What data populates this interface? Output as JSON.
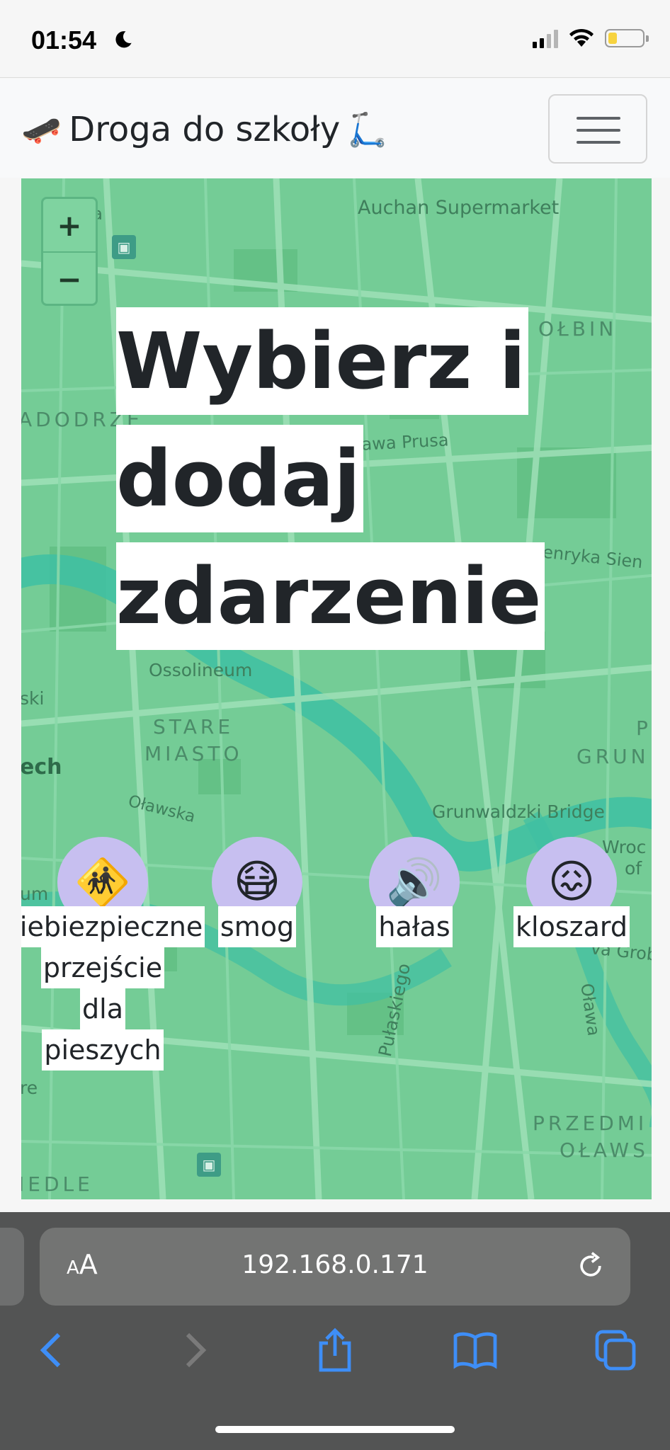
{
  "status_bar": {
    "time": "01:54",
    "battery_level": 0.25
  },
  "navbar": {
    "brand_text": "Droga do szkoły",
    "brand_emoji_left": "🛹",
    "brand_emoji_right": "🛴"
  },
  "map": {
    "zoom_in": "+",
    "zoom_out": "−",
    "labels": {
      "l1": "owska",
      "l2": "Auchan Supermarket",
      "l3": "OŁBIN",
      "l4": "ADODRZE",
      "l5": "olesława Prusa",
      "l6": "Henryka Sien",
      "l7": "Ossolineum",
      "l8": "ski",
      "l9": "STARE",
      "l10": "MIASTO",
      "l11": "ech",
      "l12": "Oławska",
      "l13": "Grunwaldzki Bridge",
      "l14": "GRUN",
      "l15": "P",
      "l16": "Wroc",
      "l17": "of",
      "l18": "um",
      "l19": "va Grob",
      "l20": "Oława",
      "l21": "Pułaskiego",
      "l22": "re",
      "l23": "PRZEDMI",
      "l24": "OŁAWS",
      "l25": "IEDLE"
    }
  },
  "headline": [
    "Wybierz i",
    "dodaj",
    "zdarzenie"
  ],
  "categories": [
    {
      "emoji": "🚸",
      "label_lines": [
        "niebiezpieczne",
        "przejście",
        "dla",
        "pieszych"
      ]
    },
    {
      "emoji": "😷",
      "label_lines": [
        "smog"
      ]
    },
    {
      "emoji": "🔊",
      "label_lines": [
        "hałas"
      ]
    },
    {
      "emoji": "😖",
      "label_lines": [
        "kloszard"
      ]
    }
  ],
  "browser": {
    "aa_small": "A",
    "aa_big": "A",
    "url": "192.168.0.171"
  },
  "colors": {
    "accent": "#3e8ef7",
    "map_green": "#74cc96",
    "category_circle": "#c7bff0"
  }
}
